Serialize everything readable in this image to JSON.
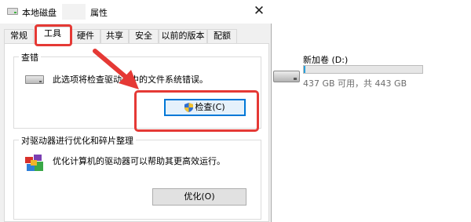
{
  "dialog": {
    "title_prefix": "本地磁盘",
    "title_suffix": "属性",
    "close_glyph": "✕"
  },
  "tabs": [
    {
      "label": "常规",
      "active": false
    },
    {
      "label": "工具",
      "active": true
    },
    {
      "label": "硬件",
      "active": false
    },
    {
      "label": "共享",
      "active": false
    },
    {
      "label": "安全",
      "active": false
    },
    {
      "label": "以前的版本",
      "active": false
    },
    {
      "label": "配额",
      "active": false
    }
  ],
  "error_check": {
    "group_label": "查错",
    "description": "此选项将检查驱动器中的文件系统错误。",
    "button_label": "检查(C)",
    "icon": "drive-icon"
  },
  "optimize": {
    "group_label": "对驱动器进行优化和碎片整理",
    "description": "优化计算机的驱动器可以帮助其更高效运行。",
    "button_label": "优化(O)",
    "icon": "defrag-icon"
  },
  "explorer": {
    "drive_name": "新加卷 (D:)",
    "space_text": "437 GB 可用，共 443 GB",
    "used_fraction": 0.014
  },
  "colors": {
    "annotation_red": "#e53935",
    "usage_blue": "#26a0da",
    "focus_blue": "#0078d7"
  }
}
